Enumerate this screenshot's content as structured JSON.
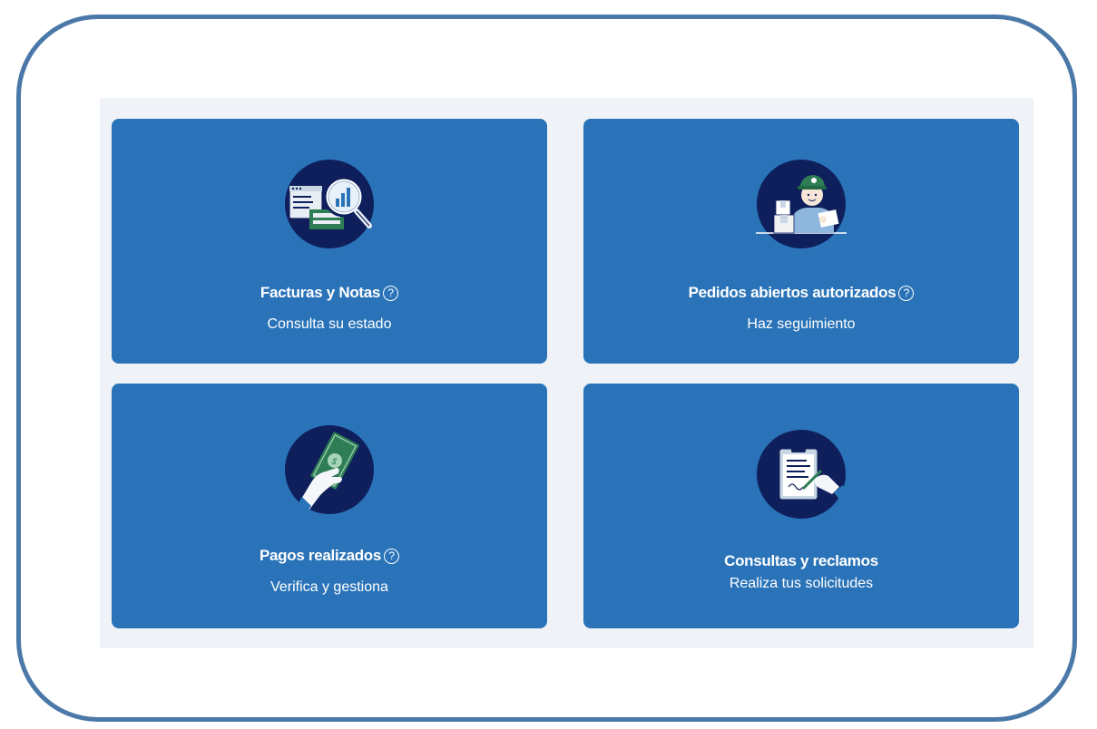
{
  "cards": [
    {
      "title": "Facturas y Notas",
      "subtitle": "Consulta su estado",
      "icon": "invoice-search-icon",
      "has_help": true
    },
    {
      "title": "Pedidos abiertos autorizados",
      "subtitle": "Haz seguimiento",
      "icon": "delivery-person-icon",
      "has_help": true
    },
    {
      "title": "Pagos realizados",
      "subtitle": "Verifica y gestiona",
      "icon": "payment-hand-icon",
      "has_help": true
    },
    {
      "title": "Consultas y reclamos",
      "subtitle": "Realiza tus solicitudes",
      "icon": "clipboard-sign-icon",
      "has_help": false
    }
  ],
  "help_glyph": "?",
  "colors": {
    "card": "#2a73b8",
    "icon_circle": "#0e1f5c",
    "frame_border": "#4a78a8",
    "panel": "#eff3f7"
  }
}
